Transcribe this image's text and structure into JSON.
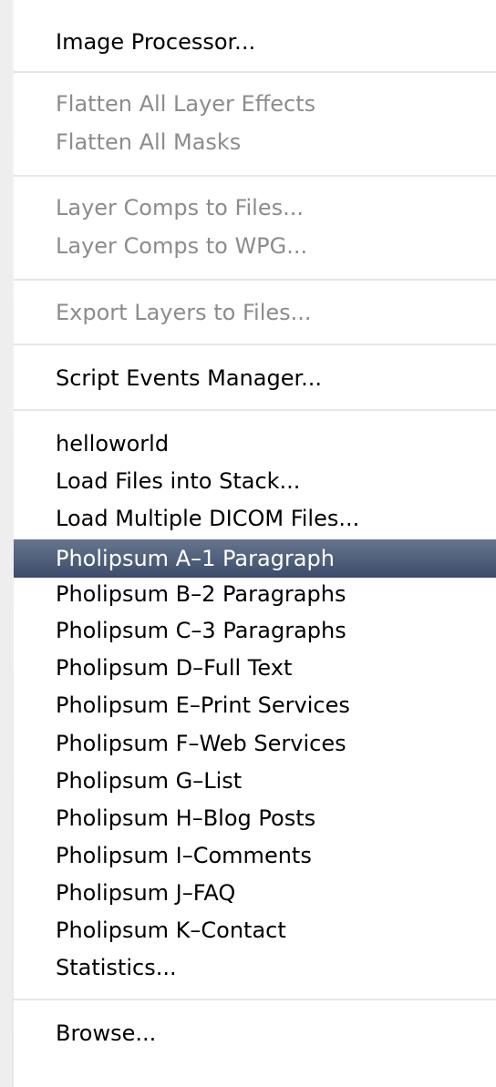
{
  "menu": {
    "items": [
      {
        "label": "Image Processor...",
        "enabled": true
      },
      {
        "label": "Flatten All Layer Effects",
        "enabled": false
      },
      {
        "label": "Flatten All Masks",
        "enabled": false
      },
      {
        "label": "Layer Comps to Files...",
        "enabled": false
      },
      {
        "label": "Layer Comps to WPG...",
        "enabled": false
      },
      {
        "label": "Export Layers to Files...",
        "enabled": false
      },
      {
        "label": "Script Events Manager...",
        "enabled": true
      },
      {
        "label": "helloworld",
        "enabled": true
      },
      {
        "label": "Load Files into Stack...",
        "enabled": true
      },
      {
        "label": "Load Multiple DICOM Files...",
        "enabled": true
      },
      {
        "label": "Pholipsum A–1 Paragraph",
        "enabled": true,
        "highlighted": true
      },
      {
        "label": "Pholipsum B–2 Paragraphs",
        "enabled": true
      },
      {
        "label": "Pholipsum C–3 Paragraphs",
        "enabled": true
      },
      {
        "label": "Pholipsum D–Full Text",
        "enabled": true
      },
      {
        "label": "Pholipsum E–Print Services",
        "enabled": true
      },
      {
        "label": "Pholipsum F–Web Services",
        "enabled": true
      },
      {
        "label": "Pholipsum G–List",
        "enabled": true
      },
      {
        "label": "Pholipsum H–Blog Posts",
        "enabled": true
      },
      {
        "label": "Pholipsum I–Comments",
        "enabled": true
      },
      {
        "label": "Pholipsum J–FAQ",
        "enabled": true
      },
      {
        "label": "Pholipsum K–Contact",
        "enabled": true
      },
      {
        "label": "Statistics...",
        "enabled": true
      },
      {
        "label": "Browse...",
        "enabled": true
      }
    ],
    "colors": {
      "text": "#000000",
      "disabled_text": "#8c8c8c",
      "highlight_start": "#67758d",
      "highlight_end": "#3c4c6a",
      "highlight_text": "#ffffff",
      "separator": "#e7e7e7"
    }
  }
}
